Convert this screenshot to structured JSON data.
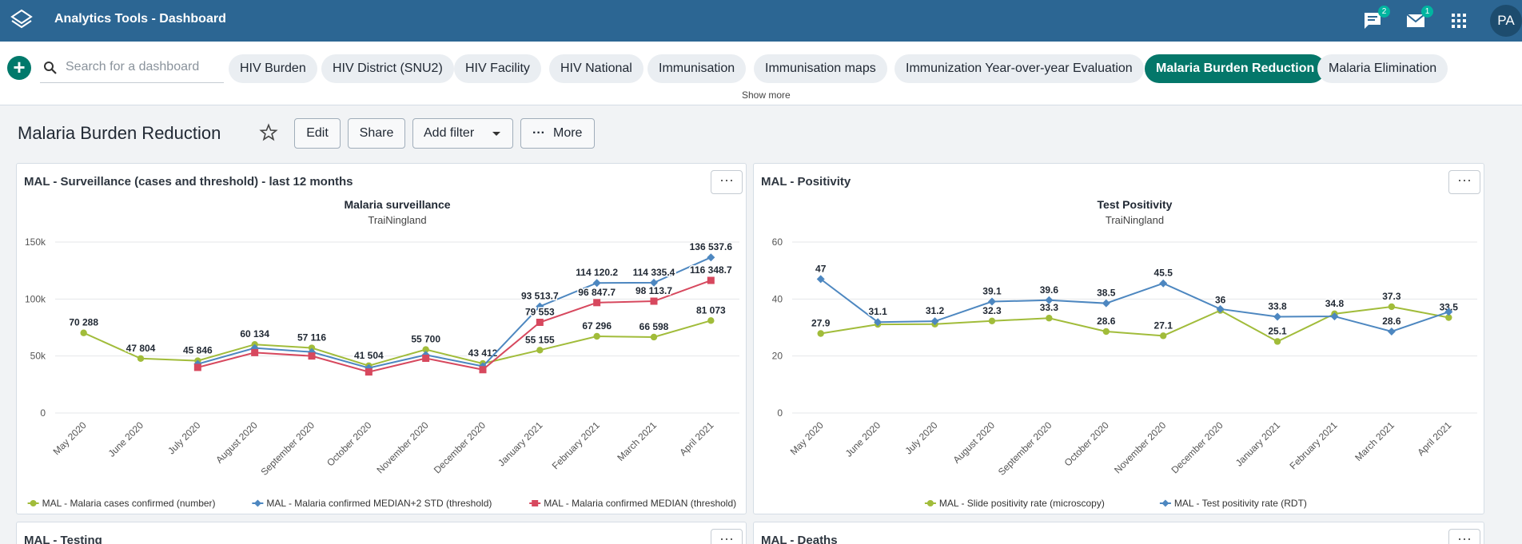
{
  "header": {
    "app_title": "Analytics Tools - Dashboard",
    "messages_badge": "2",
    "mail_badge": "1",
    "avatar_initials": "PA",
    "color": "#2c6693"
  },
  "dashboard_bar": {
    "search_placeholder": "Search for a dashboard",
    "chips": [
      {
        "label": "HIV Burden"
      },
      {
        "label": "HIV District (SNU2)"
      },
      {
        "label": "HIV Facility"
      },
      {
        "label": "HIV National"
      },
      {
        "label": "Immunisation"
      },
      {
        "label": "Immunisation maps"
      },
      {
        "label": "Immunization Year-over-year Evaluation"
      },
      {
        "label": "Malaria Burden Reduction",
        "active": true
      },
      {
        "label": "Malaria Elimination"
      }
    ],
    "show_more": "Show more",
    "active_color": "#04776a"
  },
  "page": {
    "title": "Malaria Burden Reduction",
    "buttons": {
      "edit": "Edit",
      "share": "Share",
      "add_filter": "Add filter",
      "more": "More"
    }
  },
  "cards": [
    {
      "title": "MAL - Surveillance (cases and threshold) - last 12 months"
    },
    {
      "title": "MAL - Positivity"
    },
    {
      "title": "MAL - Testing"
    },
    {
      "title": "MAL - Deaths"
    }
  ],
  "chart_data": [
    {
      "type": "line",
      "title": "Malaria surveillance",
      "subtitle": "TraiNingland",
      "categories": [
        "May 2020",
        "June 2020",
        "July 2020",
        "August 2020",
        "September 2020",
        "October 2020",
        "November 2020",
        "December 2020",
        "January 2021",
        "February 2021",
        "March 2021",
        "April 2021"
      ],
      "ylim": [
        0,
        150000
      ],
      "yticks": [
        0,
        50000,
        100000,
        150000
      ],
      "ytick_labels": [
        "0",
        "50k",
        "100k",
        "150k"
      ],
      "grid": true,
      "legend": "bottom",
      "series": [
        {
          "name": "MAL - Malaria cases confirmed (number)",
          "color": "#a1bc3a",
          "marker": "circle",
          "values": [
            70288,
            47804,
            45846,
            60134,
            57116,
            41504,
            55700,
            43412,
            55155,
            67296,
            66598,
            81073
          ],
          "labels": [
            "70 288",
            "47 804",
            "45 846",
            "60 134",
            "57 116",
            "41 504",
            "55 700",
            "43 412",
            "55 155",
            "67 296",
            "66 598",
            "81 073"
          ]
        },
        {
          "name": "MAL - Malaria confirmed MEDIAN+2 STD (threshold)",
          "color": "#4d87c0",
          "marker": "diamond",
          "values": [
            null,
            null,
            43000,
            57000,
            53500,
            39500,
            51000,
            41000,
            93513.7,
            114120.2,
            114335.4,
            136537.6
          ],
          "labels": [
            "",
            "",
            "",
            "",
            "",
            "",
            "",
            "",
            "93 513.7",
            "114 120.2",
            "114 335.4",
            "136 537.6"
          ]
        },
        {
          "name": "MAL - Malaria confirmed MEDIAN (threshold)",
          "color": "#d7485e",
          "marker": "square",
          "values": [
            null,
            null,
            40000,
            53000,
            50000,
            36000,
            48000,
            38000,
            79553,
            96847.7,
            98113.7,
            116348.7
          ],
          "labels": [
            "",
            "",
            "",
            "",
            "",
            "",
            "",
            "",
            "79 553",
            "96 847.7",
            "98 113.7",
            "116 348.7"
          ]
        }
      ]
    },
    {
      "type": "line",
      "title": "Test Positivity",
      "subtitle": "TraiNingland",
      "categories": [
        "May 2020",
        "June 2020",
        "July 2020",
        "August 2020",
        "September 2020",
        "October 2020",
        "November 2020",
        "December 2020",
        "January 2021",
        "February 2021",
        "March 2021",
        "April 2021"
      ],
      "ylim": [
        0,
        60
      ],
      "yticks": [
        0,
        20,
        40,
        60
      ],
      "ytick_labels": [
        "0",
        "20",
        "40",
        "60"
      ],
      "grid": true,
      "legend": "bottom",
      "series": [
        {
          "name": "MAL - Slide positivity rate (microscopy)",
          "color": "#a1bc3a",
          "marker": "circle",
          "values": [
            27.9,
            31.1,
            31.2,
            32.3,
            33.3,
            28.6,
            27.1,
            36,
            25.1,
            34.8,
            37.3,
            33.5
          ],
          "labels": [
            "27.9",
            "",
            "",
            "32.3",
            "33.3",
            "28.6",
            "27.1",
            "36",
            "25.1",
            "34.8",
            "37.3",
            "33.5"
          ]
        },
        {
          "name": "MAL - Test positivity rate (RDT)",
          "color": "#4d87c0",
          "marker": "diamond",
          "values": [
            47,
            31.9,
            32.2,
            39.1,
            39.6,
            38.5,
            45.5,
            36.5,
            33.8,
            33.9,
            28.6,
            35.5
          ],
          "labels": [
            "47",
            "31.1",
            "31.2",
            "39.1",
            "39.6",
            "38.5",
            "45.5",
            "",
            "33.8",
            "",
            "28.6",
            ""
          ]
        }
      ]
    }
  ]
}
